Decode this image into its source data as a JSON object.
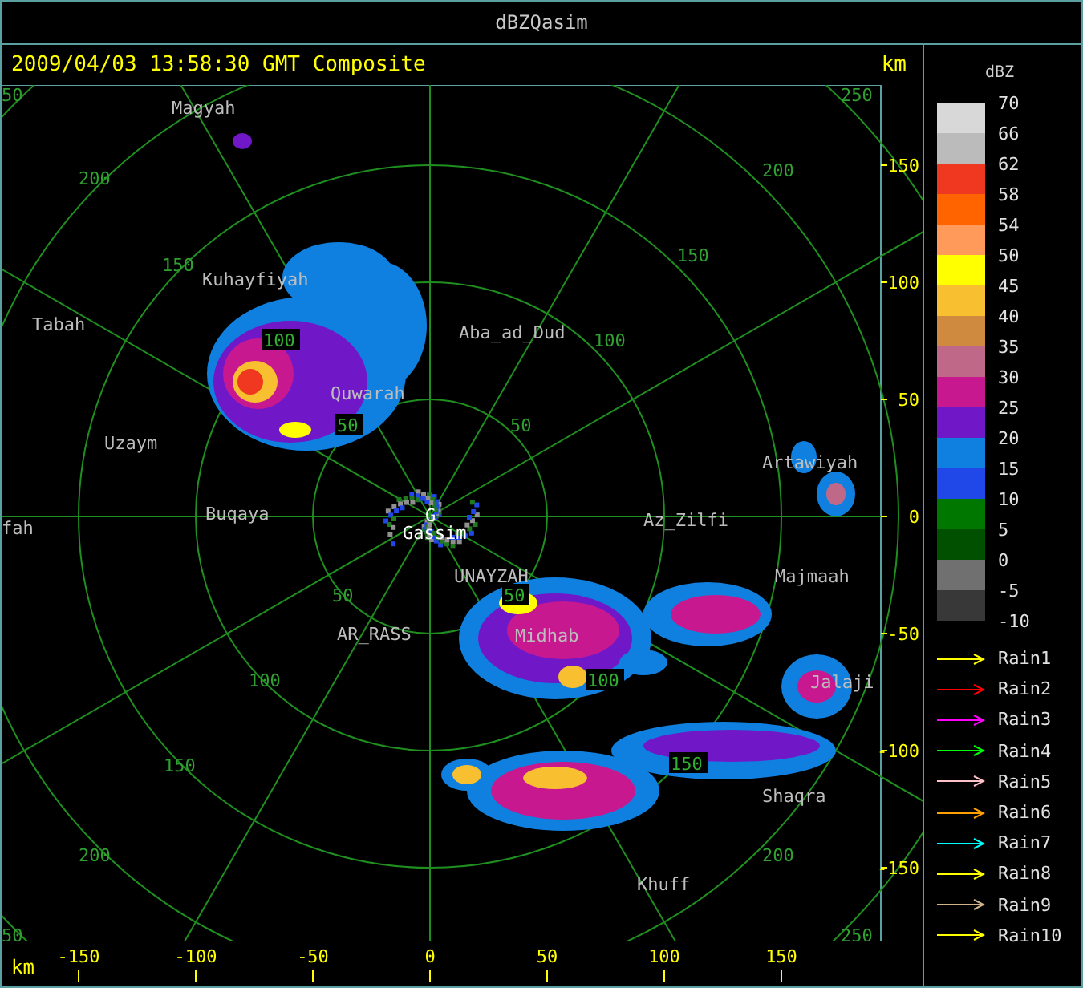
{
  "window": {
    "title": "dBZQasim"
  },
  "header": {
    "caption": "2009/04/03 13:58:30 GMT Composite",
    "unit": "km"
  },
  "map": {
    "places": [
      {
        "name": "Magyah",
        "kind": "town"
      },
      {
        "name": "Kuhayfiyah",
        "kind": "town"
      },
      {
        "name": "Tabah",
        "kind": "town"
      },
      {
        "name": "Aba_ad_Dud",
        "kind": "town"
      },
      {
        "name": "Quwarah",
        "kind": "town"
      },
      {
        "name": "Uzaym",
        "kind": "town"
      },
      {
        "name": "Artawiyah",
        "kind": "town"
      },
      {
        "name": "fah",
        "kind": "town"
      },
      {
        "name": "Buqaya",
        "kind": "town"
      },
      {
        "name": "G",
        "kind": "radar"
      },
      {
        "name": "Gassim",
        "kind": "radar"
      },
      {
        "name": "Az_Zilfi",
        "kind": "town"
      },
      {
        "name": "UNAYZAH",
        "kind": "town"
      },
      {
        "name": "Majmaah",
        "kind": "town"
      },
      {
        "name": "AR_RASS",
        "kind": "town"
      },
      {
        "name": "Midhab",
        "kind": "town"
      },
      {
        "name": "Jalaji",
        "kind": "town"
      },
      {
        "name": "Shaqra",
        "kind": "town"
      },
      {
        "name": "Khuff",
        "kind": "town"
      }
    ],
    "range_labels": [
      {
        "text": "50",
        "kind": "plain"
      },
      {
        "text": "250",
        "kind": "plain"
      },
      {
        "text": "50",
        "kind": "plain"
      },
      {
        "text": "250",
        "kind": "plain"
      },
      {
        "text": "200",
        "kind": "plain"
      },
      {
        "text": "150",
        "kind": "plain"
      },
      {
        "text": "100",
        "kind": "boxed"
      },
      {
        "text": "50",
        "kind": "boxed"
      },
      {
        "text": "50",
        "kind": "plain"
      },
      {
        "text": "100",
        "kind": "plain"
      },
      {
        "text": "150",
        "kind": "plain"
      },
      {
        "text": "200",
        "kind": "plain"
      },
      {
        "text": "50",
        "kind": "boxed"
      },
      {
        "text": "100",
        "kind": "boxed"
      },
      {
        "text": "150",
        "kind": "boxed"
      },
      {
        "text": "200",
        "kind": "plain"
      },
      {
        "text": "50",
        "kind": "plain"
      },
      {
        "text": "100",
        "kind": "plain"
      },
      {
        "text": "150",
        "kind": "plain"
      },
      {
        "text": "200",
        "kind": "plain"
      }
    ],
    "y_ticks": [
      "150",
      "100",
      "50",
      "0",
      "-50",
      "-100",
      "-150"
    ],
    "x_unit": "km",
    "x_ticks": [
      "-150",
      "-100",
      "-50",
      "0",
      "50",
      "100",
      "150"
    ]
  },
  "legend": {
    "title": "dBZ",
    "labels": [
      "70",
      "66",
      "62",
      "58",
      "54",
      "50",
      "45",
      "40",
      "35",
      "30",
      "25",
      "20",
      "15",
      "10",
      "5",
      "0",
      "-5",
      "-10"
    ],
    "bins": [
      {
        "color": "#d8d8d8"
      },
      {
        "color": "#bbbbbb"
      },
      {
        "color": "#f03820"
      },
      {
        "color": "#ff6400"
      },
      {
        "color": "#ff9a5a"
      },
      {
        "color": "#ffff00"
      },
      {
        "color": "#f8c030"
      },
      {
        "color": "#d08a40"
      },
      {
        "color": "#c06888"
      },
      {
        "color": "#c81890"
      },
      {
        "color": "#7018c8"
      },
      {
        "color": "#1080e0"
      },
      {
        "color": "#2048e8"
      },
      {
        "color": "#007800"
      },
      {
        "color": "#005000"
      },
      {
        "color": "#707070"
      },
      {
        "color": "#383838"
      }
    ],
    "tracks": [
      {
        "label": "Rain1",
        "color": "#ffff00"
      },
      {
        "label": "Rain2",
        "color": "#ff0000"
      },
      {
        "label": "Rain3",
        "color": "#ff00ff"
      },
      {
        "label": "Rain4",
        "color": "#00ff00"
      },
      {
        "label": "Rain5",
        "color": "#ffc0c8"
      },
      {
        "label": "Rain6",
        "color": "#ffa000"
      },
      {
        "label": "Rain7",
        "color": "#00ffff"
      },
      {
        "label": "Rain8",
        "color": "#ffff00"
      },
      {
        "label": "Rain9",
        "color": "#d2b48c"
      },
      {
        "label": "Rain10",
        "color": "#ffff00"
      }
    ]
  }
}
